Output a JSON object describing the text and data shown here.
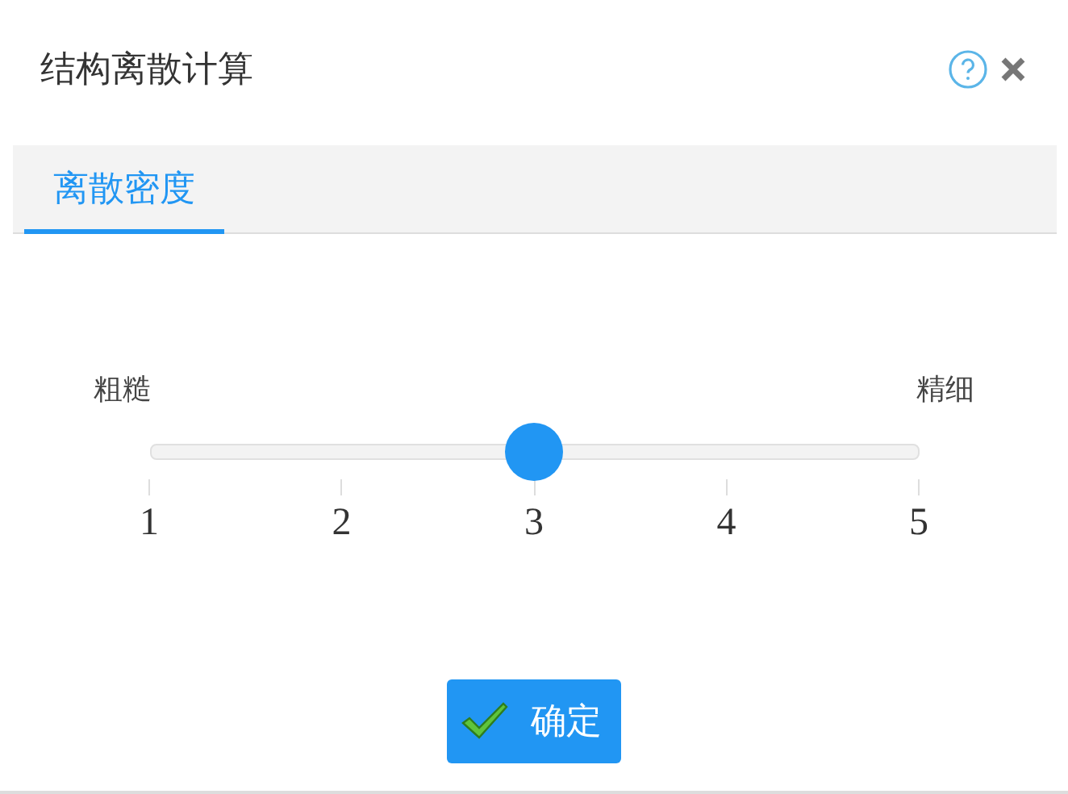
{
  "dialog": {
    "title": "结构离散计算"
  },
  "tabs": [
    {
      "label": "离散密度",
      "selected": true
    }
  ],
  "slider": {
    "min_label": "粗糙",
    "max_label": "精细",
    "level": 0.5,
    "ticks": [
      "1",
      "2",
      "3",
      "4",
      "5"
    ]
  },
  "buttons": [
    {
      "label": "确定"
    }
  ]
}
